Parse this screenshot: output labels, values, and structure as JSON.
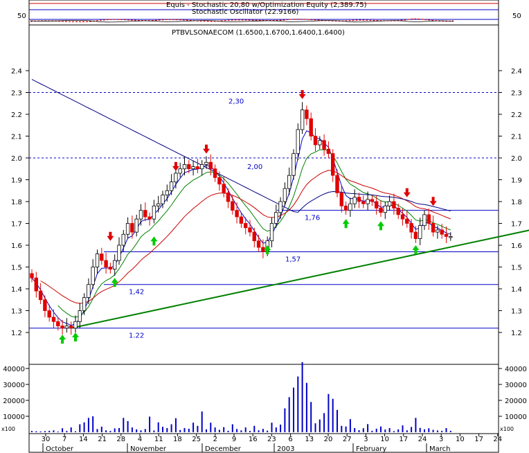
{
  "window": {
    "top_panel_title_1": "Equis - Stochastic 20,80 w/Optimization Equity (2,389.75)",
    "top_panel_title_2": "Stochastic Oscillator (22.9166)",
    "top_panel_left_value": "50",
    "top_panel_right_value": "50",
    "main_title": "PTBVLSONAECOM (1.6500,1.6700,1.6400,1.6400)",
    "volume_scale_label_left": "x100",
    "volume_scale_label_right": "x100"
  },
  "colors": {
    "candle_up": "#ffffff",
    "candle_down": "#e00000",
    "candle_outline": "#000000",
    "buy_arrow": "#00cc00",
    "sell_arrow": "#e00000",
    "level_line": "#0000c8",
    "trend_line": "#008000",
    "ma_fast": "#0000c8",
    "ma_mid": "#008000",
    "ma_slow": "#cc0000",
    "ma_long": "#000080",
    "volume": "#0000c8"
  },
  "chart_data": [
    {
      "type": "candlestick",
      "title": "PTBVLSONAECOM (1.6500,1.6700,1.6400,1.6400)",
      "ylim": [
        1.15,
        2.45
      ],
      "yticks": [
        1.2,
        1.3,
        1.4,
        1.5,
        1.6,
        1.7,
        1.8,
        1.9,
        2.0,
        2.1,
        2.2,
        2.3,
        2.4
      ],
      "x_ticks": [
        "30",
        "7",
        "14",
        "21",
        "28",
        "4",
        "11",
        "18",
        "25",
        "2",
        "9",
        "16",
        "23",
        "6",
        "13",
        "20",
        "27",
        "3",
        "10",
        "17",
        "24",
        "3",
        "10",
        "17",
        "24"
      ],
      "month_labels": [
        "October",
        "November",
        "December",
        "2003",
        "February",
        "March"
      ],
      "horizontal_levels": [
        {
          "label": "2,30",
          "value": 2.3,
          "style": "dashed"
        },
        {
          "label": "2,00",
          "value": 2.0,
          "style": "dashed"
        },
        {
          "label": "1,76",
          "value": 1.76,
          "style": "solid"
        },
        {
          "label": "1,57",
          "value": 1.57,
          "style": "solid"
        },
        {
          "label": "1,42",
          "value": 1.42,
          "style": "solid"
        },
        {
          "label": "1.22",
          "value": 1.22,
          "style": "solid"
        }
      ],
      "trendline": {
        "from": [
          9,
          1.22
        ],
        "to": [
          215,
          2.1
        ]
      },
      "closes": [
        1.45,
        1.39,
        1.35,
        1.3,
        1.27,
        1.25,
        1.23,
        1.22,
        1.23,
        1.22,
        1.25,
        1.3,
        1.36,
        1.42,
        1.5,
        1.56,
        1.53,
        1.5,
        1.49,
        1.53,
        1.6,
        1.65,
        1.7,
        1.66,
        1.72,
        1.76,
        1.73,
        1.72,
        1.78,
        1.79,
        1.83,
        1.85,
        1.89,
        1.93,
        1.95,
        1.97,
        1.95,
        1.96,
        1.95,
        1.97,
        1.98,
        1.95,
        1.91,
        1.88,
        1.84,
        1.8,
        1.76,
        1.73,
        1.7,
        1.68,
        1.66,
        1.62,
        1.59,
        1.57,
        1.62,
        1.7,
        1.75,
        1.8,
        1.86,
        1.92,
        2.02,
        2.13,
        2.22,
        2.18,
        2.1,
        2.06,
        2.08,
        2.04,
        2.02,
        1.92,
        1.84,
        1.78,
        1.76,
        1.79,
        1.82,
        1.8,
        1.79,
        1.81,
        1.8,
        1.77,
        1.75,
        1.78,
        1.8,
        1.77,
        1.74,
        1.72,
        1.7,
        1.66,
        1.63,
        1.69,
        1.74,
        1.7,
        1.66,
        1.67,
        1.65,
        1.64,
        1.64
      ],
      "buy_signals": [
        {
          "index": 7,
          "price": 1.19
        },
        {
          "index": 10,
          "price": 1.2
        },
        {
          "index": 19,
          "price": 1.45
        },
        {
          "index": 28,
          "price": 1.64
        },
        {
          "index": 54,
          "price": 1.6
        },
        {
          "index": 72,
          "price": 1.72
        },
        {
          "index": 80,
          "price": 1.71
        },
        {
          "index": 88,
          "price": 1.6
        }
      ],
      "sell_signals": [
        {
          "index": 18,
          "price": 1.62
        },
        {
          "index": 33,
          "price": 1.94
        },
        {
          "index": 40,
          "price": 2.02
        },
        {
          "index": 62,
          "price": 2.27
        },
        {
          "index": 86,
          "price": 1.82
        },
        {
          "index": 92,
          "price": 1.78
        }
      ],
      "moving_averages": [
        {
          "color": "#0000c8",
          "period": "fast"
        },
        {
          "color": "#008000",
          "period": "mid"
        },
        {
          "color": "#cc0000",
          "period": "slow"
        },
        {
          "color": "#000080",
          "period": "long"
        }
      ]
    },
    {
      "type": "bar",
      "title": "",
      "ylim": [
        0,
        48000
      ],
      "yticks": [
        10000,
        20000,
        30000,
        40000
      ],
      "values": [
        800,
        600,
        500,
        700,
        900,
        1200,
        400,
        2500,
        800,
        3000,
        600,
        5000,
        6200,
        9000,
        10000,
        2000,
        3500,
        1200,
        800,
        2400,
        2600,
        9000,
        7000,
        3000,
        1800,
        1200,
        2000,
        9800,
        1100,
        6200,
        3400,
        2600,
        5000,
        8800,
        1400,
        2600,
        2200,
        6000,
        4000,
        13000,
        1800,
        6000,
        3000,
        1500,
        3200,
        900,
        5000,
        2000,
        1200,
        3000,
        800,
        4000,
        1200,
        2100,
        1000,
        6000,
        3000,
        4800,
        15000,
        22000,
        28000,
        35000,
        44000,
        31000,
        19000,
        5600,
        8000,
        12000,
        24000,
        21000,
        14000,
        4000,
        3600,
        8200,
        2600,
        1300,
        2500,
        5100,
        900,
        2200,
        3600,
        1700,
        2600,
        700,
        1800,
        4300,
        1200,
        3300,
        9000,
        2700,
        1800,
        2500,
        1500,
        1100,
        900,
        2600,
        900
      ]
    }
  ]
}
